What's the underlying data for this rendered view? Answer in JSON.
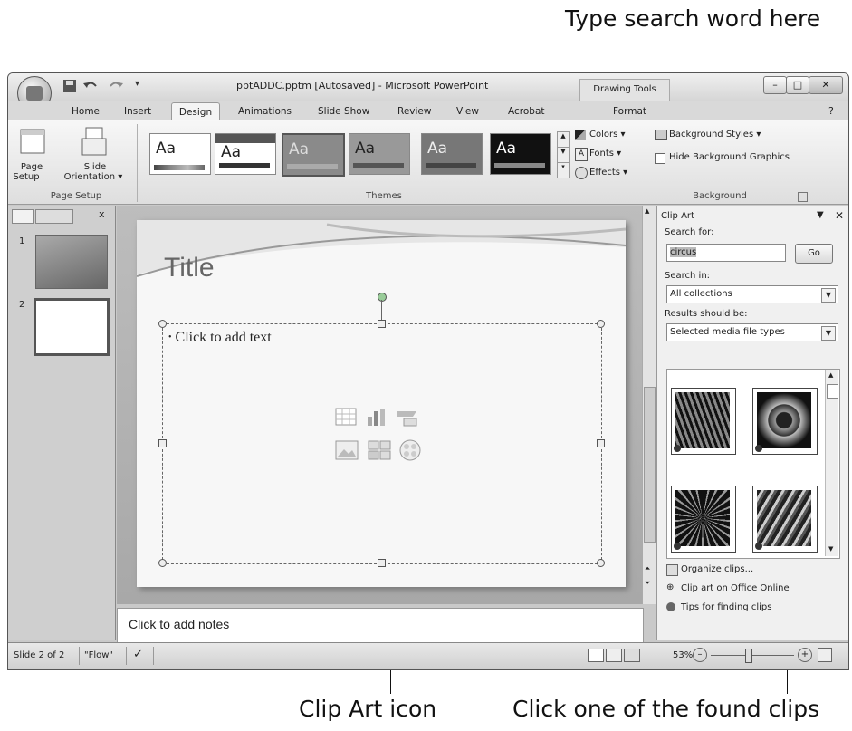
{
  "callouts": {
    "search_word": "Type search word here",
    "clip_art_icon": "Clip Art icon",
    "found_clips": "Click one of the found clips"
  },
  "window": {
    "title": "pptADDC.pptm [Autosaved] - Microsoft PowerPoint",
    "contextual_tab": "Drawing Tools",
    "qat": {
      "save": "save-icon",
      "undo": "undo-icon",
      "redo": "redo-icon",
      "customize": "▾"
    }
  },
  "tabs": [
    "Home",
    "Insert",
    "Design",
    "Animations",
    "Slide Show",
    "Review",
    "View",
    "Acrobat",
    "Format"
  ],
  "active_tab": "Design",
  "ribbon": {
    "page_setup": {
      "page_setup_label_1": "Page",
      "page_setup_label_2": "Setup",
      "slide_orientation_label_1": "Slide",
      "slide_orientation_label_2": "Orientation ▾",
      "group_label": "Page Setup"
    },
    "themes": {
      "sample": "Aa",
      "group_label": "Themes",
      "colors": "Colors ▾",
      "fonts": "Fonts ▾",
      "effects": "Effects ▾"
    },
    "background": {
      "styles": "Background Styles ▾",
      "hide": "Hide Background Graphics",
      "group_label": "Background"
    }
  },
  "slides_pane": {
    "numbers": [
      "1",
      "2"
    ],
    "close": "x"
  },
  "slide": {
    "title": "Title",
    "body": "Click to add text"
  },
  "notes": "Click to add notes",
  "task_pane": {
    "title": "Clip Art",
    "search_for_label": "Search for:",
    "search_value": "circus",
    "go": "Go",
    "search_in_label": "Search in:",
    "search_in_value": "All collections",
    "results_label": "Results should be:",
    "results_value": "Selected media file types",
    "links": [
      "Organize clips...",
      "Clip art on Office Online",
      "Tips for finding clips"
    ]
  },
  "status": {
    "slide": "Slide 2 of 2",
    "theme": "\"Flow\"",
    "zoom": "53%",
    "zoom_level": 0.53
  }
}
